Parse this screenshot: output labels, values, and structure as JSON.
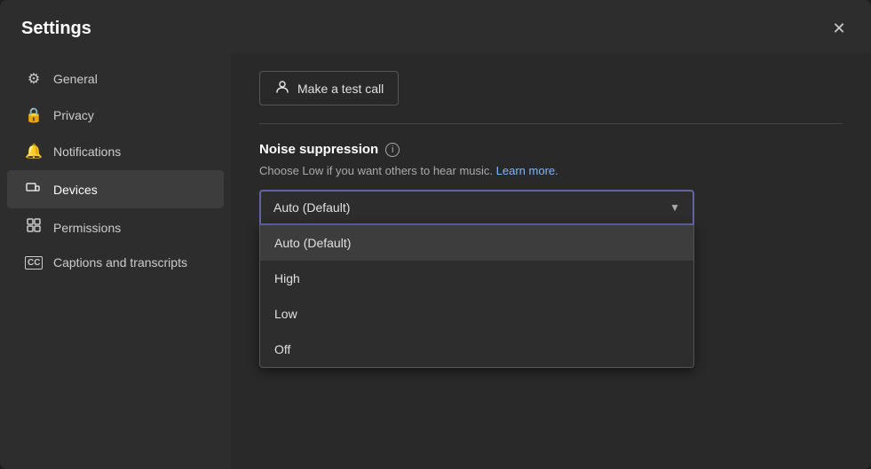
{
  "window": {
    "title": "Settings",
    "close_label": "✕"
  },
  "sidebar": {
    "items": [
      {
        "id": "general",
        "label": "General",
        "icon": "⚙",
        "active": false
      },
      {
        "id": "privacy",
        "label": "Privacy",
        "icon": "🔒",
        "active": false
      },
      {
        "id": "notifications",
        "label": "Notifications",
        "icon": "🔔",
        "active": false
      },
      {
        "id": "devices",
        "label": "Devices",
        "icon": "📱",
        "active": true
      },
      {
        "id": "permissions",
        "label": "Permissions",
        "icon": "⊞",
        "active": false
      },
      {
        "id": "captions",
        "label": "Captions and transcripts",
        "icon": "CC",
        "active": false
      }
    ]
  },
  "main": {
    "test_call_button": "Make a test call",
    "test_call_icon": "👤",
    "noise_section": {
      "title": "Noise suppression",
      "description_prefix": "Choose Low if you want others to hear music.",
      "learn_more_label": "Learn more.",
      "selected_option": "Auto (Default)",
      "options": [
        {
          "label": "Auto (Default)",
          "selected": true
        },
        {
          "label": "High",
          "selected": false
        },
        {
          "label": "Low",
          "selected": false
        },
        {
          "label": "Off",
          "selected": false
        }
      ]
    }
  }
}
